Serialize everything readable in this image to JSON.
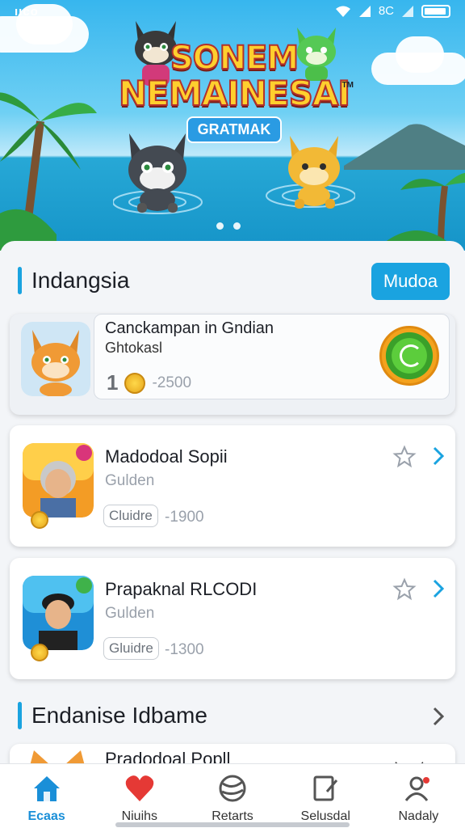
{
  "status_bar": {
    "left": "ııco",
    "signal_text": "8C"
  },
  "hero": {
    "title_line1": "SONEM",
    "title_line2": "NEMAINESAI",
    "tm": "TM",
    "subtitle": "GRATMAK",
    "carousel_pages": 2
  },
  "section1": {
    "title": "Indangsia",
    "action_button": "Mudoa"
  },
  "featured": {
    "title": "Canckampan in Gndian",
    "subtitle": "Ghtokasl",
    "rank": "1",
    "price": "-2500"
  },
  "items": [
    {
      "title": "Madodoal Sopii",
      "subtitle": "Gulden",
      "tag": "Cluidre",
      "price": "-1900"
    },
    {
      "title": "Prapaknal RLCODI",
      "subtitle": "Gulden",
      "tag": "Gluidre",
      "price": "-1300"
    }
  ],
  "section2": {
    "title": "Endanise Idbame",
    "peek_item_title": "Pradodoal Popll"
  },
  "bottom_nav": [
    {
      "label": "Ecaas",
      "icon": "home-icon",
      "active": true
    },
    {
      "label": "Niuihs",
      "icon": "heart-icon",
      "active": false
    },
    {
      "label": "Retarts",
      "icon": "ball-icon",
      "active": false
    },
    {
      "label": "Selusdal",
      "icon": "document-edit-icon",
      "active": false
    },
    {
      "label": "Nadaly",
      "icon": "profile-icon",
      "active": false
    }
  ],
  "colors": {
    "accent": "#1aa3e0",
    "heart": "#e53935",
    "coin": "#f3a21d"
  }
}
